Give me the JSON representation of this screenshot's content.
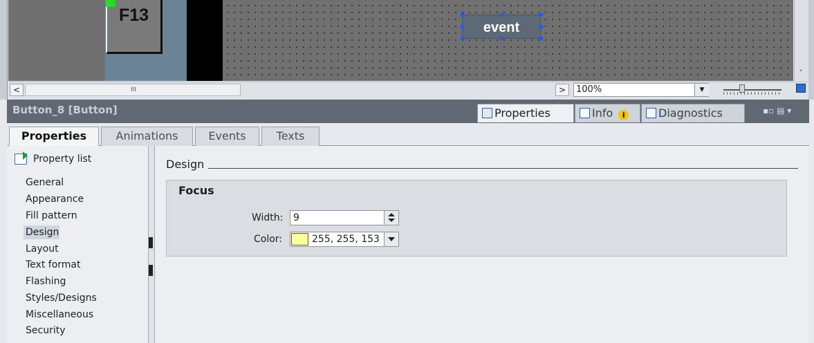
{
  "canvas": {
    "f13_button_label": "F13",
    "event_button_label": "event",
    "zoom_value": "100%",
    "hscroll_grip": "III",
    "hscroll_left_arrow": "<",
    "hscroll_right_arrow": ">",
    "vscroll_down_arrow": "˅"
  },
  "inspector": {
    "title": "Button_8 [Button]",
    "top_tabs": {
      "properties": "Properties",
      "info": "Info",
      "info_warning": "i",
      "diagnostics": "Diagnostics"
    },
    "window_controls": "▪▫ ▤ ▾",
    "lower_tabs": {
      "properties": "Properties",
      "animations": "Animations",
      "events": "Events",
      "texts": "Texts"
    }
  },
  "nav": {
    "property_list": "Property list",
    "items": [
      "General",
      "Appearance",
      "Fill pattern",
      "Design",
      "Layout",
      "Text format",
      "Flashing",
      "Styles/Designs",
      "Miscellaneous",
      "Security"
    ],
    "selected": "Design"
  },
  "content": {
    "section_title": "Design",
    "group_title": "Focus",
    "width_label": "Width:",
    "width_value": "9",
    "color_label": "Color:",
    "color_value": "255, 255, 153",
    "color_swatch": "#ffff99"
  },
  "colors": {
    "accent_selection": "#1a5cff",
    "header_bg": "#5f6873",
    "handle_green": "#22dd22"
  },
  "icons": [
    "properties-tab-icon",
    "info-tab-icon",
    "warning-icon",
    "diagnostics-tab-icon",
    "property-list-icon",
    "zoom-fit-icon"
  ]
}
